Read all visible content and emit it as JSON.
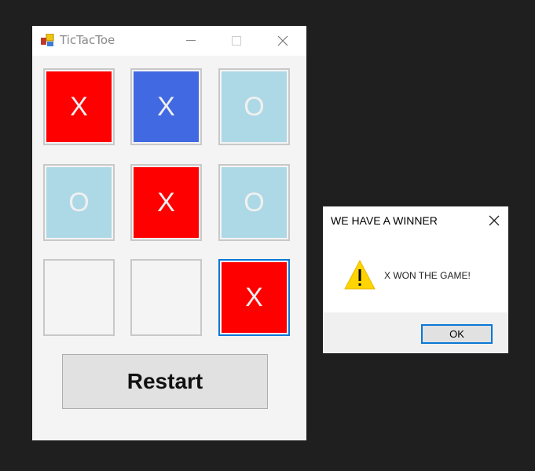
{
  "window": {
    "title": "TicTacToe",
    "icon": "app-icon"
  },
  "board": {
    "cells": [
      {
        "mark": "X",
        "color": "#ff0000"
      },
      {
        "mark": "X",
        "color": "#4169e1"
      },
      {
        "mark": "O",
        "color": "#add8e6"
      },
      {
        "mark": "O",
        "color": "#add8e6"
      },
      {
        "mark": "X",
        "color": "#ff0000"
      },
      {
        "mark": "O",
        "color": "#add8e6"
      },
      {
        "mark": "",
        "color": "#f4f4f4"
      },
      {
        "mark": "",
        "color": "#f4f4f4"
      },
      {
        "mark": "X",
        "color": "#ff0000"
      }
    ]
  },
  "restart_label": "Restart",
  "dialog": {
    "title": "WE HAVE A WINNER",
    "message": "X WON THE GAME!",
    "icon": "warning-icon",
    "ok_label": "OK"
  }
}
